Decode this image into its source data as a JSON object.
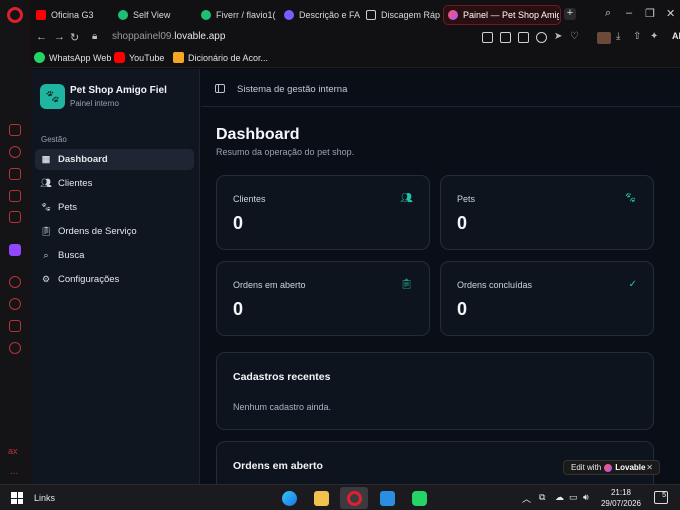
{
  "browser": {
    "tabs": [
      {
        "label": "Oficina G3",
        "color": "#ff0000"
      },
      {
        "label": "Self View",
        "color": "#1dbf73"
      },
      {
        "label": "Fiverr / flavio1(",
        "color": "#1dbf73"
      },
      {
        "label": "Descrição e FA(",
        "color": "#7b5cff"
      },
      {
        "label": "Discagem Ráp",
        "color": "#cfcfcf"
      },
      {
        "label": "Painel — Pet Shop Amigo",
        "color": "#ff5a5f"
      }
    ],
    "new_tab": "+",
    "url_prefix": "shoppainel09.",
    "url_main": "lovable.app",
    "ai_label": "AI",
    "bookmarks": [
      {
        "label": "WhatsApp Web",
        "color": "#25d366"
      },
      {
        "label": "YouTube",
        "color": "#ff0000"
      },
      {
        "label": "Dicionário de Acor...",
        "color": "#f5a623"
      }
    ]
  },
  "rail": {
    "ax": "ax",
    "more": "..."
  },
  "sidebar": {
    "brand_name": "Pet Shop Amigo Fiel",
    "brand_sub": "Painel interno",
    "group": "Gestão",
    "items": [
      {
        "label": "Dashboard",
        "icon": "grid-icon"
      },
      {
        "label": "Clientes",
        "icon": "users-icon"
      },
      {
        "label": "Pets",
        "icon": "paw-icon"
      },
      {
        "label": "Ordens de Serviço",
        "icon": "clipboard-icon"
      },
      {
        "label": "Busca",
        "icon": "search-icon"
      },
      {
        "label": "Configurações",
        "icon": "gear-icon"
      }
    ]
  },
  "topbar": {
    "title": "Sistema de gestão interna"
  },
  "main": {
    "title": "Dashboard",
    "subtitle": "Resumo da operação do pet shop.",
    "stats": [
      {
        "label": "Clientes",
        "value": "0",
        "icon": "users-icon"
      },
      {
        "label": "Pets",
        "value": "0",
        "icon": "paw-icon"
      },
      {
        "label": "Ordens em aberto",
        "value": "0",
        "icon": "clipboard-icon"
      },
      {
        "label": "Ordens concluídas",
        "value": "0",
        "icon": "check-circle-icon"
      }
    ],
    "recent": {
      "title": "Cadastros recentes",
      "empty": "Nenhum cadastro ainda."
    },
    "open_orders": {
      "title": "Ordens em aberto"
    }
  },
  "lovable_badge": {
    "prefix": "Edit with",
    "brand": "Lovable"
  },
  "taskbar": {
    "links": "Links",
    "time": "21:18",
    "date": "29/07/2026",
    "notifications": "5"
  },
  "colors": {
    "accent": "#1fb5a0",
    "opera_red": "#e0202d"
  }
}
